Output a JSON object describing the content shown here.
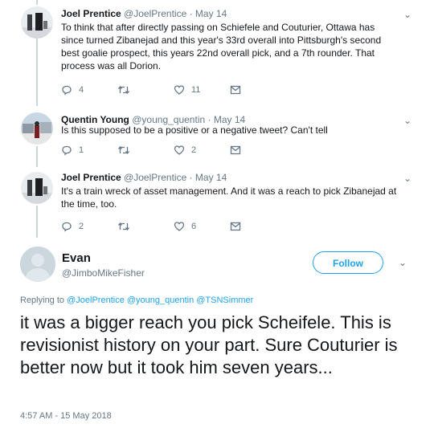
{
  "replies": [
    {
      "name": "Joel Prentice",
      "meta": "@JoelPrentice · May 14",
      "text": "To think that after directly passing on Schiefele and Couturier, Ottawa has since turned Zibanejad and this year's 33rd overall into Pittsburgh's second best goalie prospect, this years 22nd overall pick, and a 7th rounder. That process was all Dorion.",
      "reply_count": "4",
      "retweet_count": "",
      "like_count": "11"
    },
    {
      "name": "Quentin Young",
      "meta": "@young_quentin · May 14",
      "text": "Is this supposed to be a positive or a negative tweet? Can't tell",
      "reply_count": "1",
      "retweet_count": "",
      "like_count": "2"
    },
    {
      "name": "Joel Prentice",
      "meta": "@JoelPrentice · May 14",
      "text": "It's a train wreck of asset management. And it was a reach to pick Zibanejad at the time, too.",
      "reply_count": "2",
      "retweet_count": "",
      "like_count": "6"
    }
  ],
  "main": {
    "name": "Evan",
    "handle": "@JimboMikeFisher",
    "follow_label": "Follow",
    "replying_prefix": "Replying to",
    "replying_to": "@JoelPrentice @young_quentin @TSNSimmer",
    "text": "it was a bigger reach you pick Scheifele. This is revisionist history on your part. Sure Couturier is better now but it took him seven years...",
    "timestamp": "4:57 AM - 15 May 2018"
  },
  "icons": {
    "reply": "reply-icon",
    "retweet": "retweet-icon",
    "like": "heart-icon",
    "dm": "envelope-icon",
    "caret": "chevron-down-icon"
  },
  "colors": {
    "accent": "#1da1f2",
    "muted": "#657786",
    "line": "#ccd6dd"
  }
}
